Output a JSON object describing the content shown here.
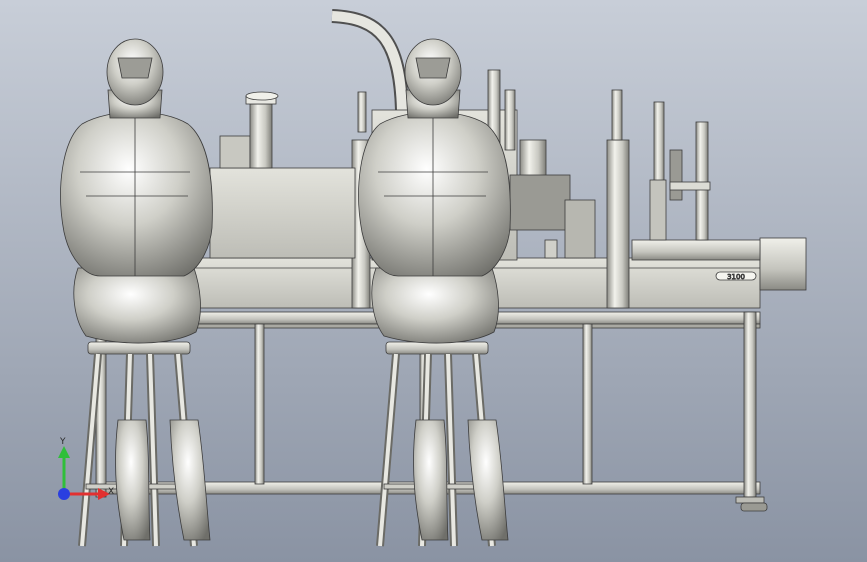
{
  "view": {
    "background_top": "#c6ccd6",
    "background_bottom": "#8f97a6",
    "model_color": "#d7d7d0",
    "model_shade": "#8d8d86",
    "edge_color": "#3c3c3c"
  },
  "triad": {
    "x_label": "X",
    "y_label": "Y",
    "x_color": "#e23030",
    "y_color": "#2fbf3a",
    "z_color": "#2a3fe0"
  },
  "model": {
    "workers": 2,
    "stools": 2,
    "frame_columns": 5,
    "label_plate": "3100"
  }
}
